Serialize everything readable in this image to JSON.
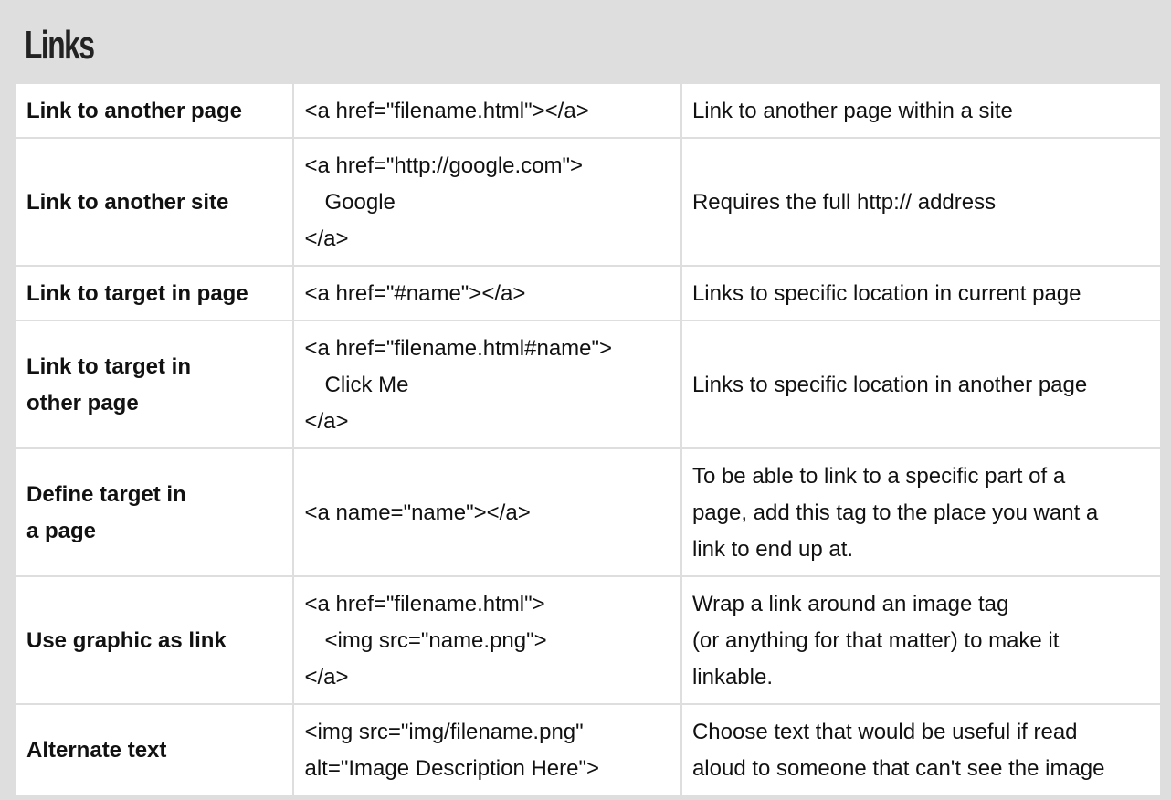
{
  "title": "Links",
  "rows": [
    {
      "name": [
        "Link to another page"
      ],
      "code": [
        "<a href=\"filename.html\"></a>"
      ],
      "desc": [
        "Link to another page within a site"
      ]
    },
    {
      "name": [
        "Link to another site"
      ],
      "code": [
        "<a href=\"http://google.com\">",
        "Google",
        "</a>"
      ],
      "desc": [
        "Requires the full http:// address"
      ]
    },
    {
      "name": [
        "Link to target in page"
      ],
      "code": [
        "<a href=\"#name\"></a>"
      ],
      "desc": [
        "Links to specific location in current page"
      ]
    },
    {
      "name": [
        "Link to target in",
        "other page"
      ],
      "code": [
        "<a href=\"filename.html#name\">",
        "Click Me",
        "</a>"
      ],
      "desc": [
        "Links to specific location in another page"
      ]
    },
    {
      "name": [
        "Define target in",
        "a page"
      ],
      "code": [
        "<a name=\"name\"></a>"
      ],
      "desc": [
        "To be able to link to a specific part of a",
        "page, add this tag to the place you want a",
        "link to end up at."
      ]
    },
    {
      "name": [
        "Use graphic as link"
      ],
      "code": [
        "<a href=\"filename.html\">",
        "<img src=\"name.png\">",
        "</a>"
      ],
      "desc": [
        "Wrap a link around an image tag",
        "(or anything for that matter) to make it",
        "linkable."
      ]
    },
    {
      "name": [
        "Alternate text"
      ],
      "code": [
        "<img src=\"img/filename.png\"",
        "alt=\"Image Description Here\">"
      ],
      "desc": [
        "Choose text that would be useful if read",
        "aloud to someone that can't see the image"
      ]
    }
  ]
}
